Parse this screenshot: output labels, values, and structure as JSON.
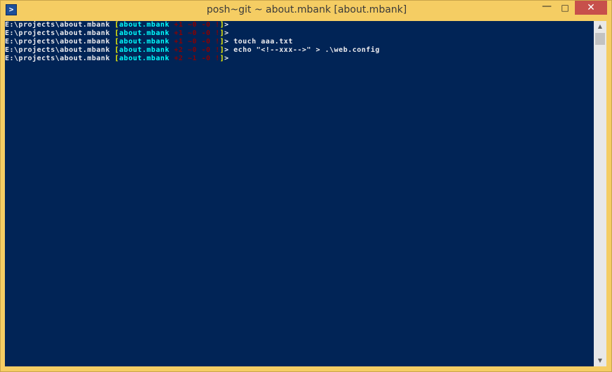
{
  "window": {
    "title": "posh~git ~ about.mbank [about.mbank]",
    "icon": "powershell-icon",
    "controls": {
      "minimize": "—",
      "maximize": "□",
      "close": "✕"
    }
  },
  "colors": {
    "console_bg": "#012456",
    "titlebar_bg": "#f5cd63",
    "path": "#eeedf0",
    "bracket": "#ffff00",
    "branch": "#00ffff",
    "status": "#8b0000",
    "close_button": "#c7504b"
  },
  "console": {
    "lines": [
      {
        "path": "E:\\projects\\about.mbank ",
        "open": "[",
        "branch": "about.mbank",
        "status": " +1 ~0 -0 !",
        "close": "]",
        "prompt": "> ",
        "command": ""
      },
      {
        "path": "E:\\projects\\about.mbank ",
        "open": "[",
        "branch": "about.mbank",
        "status": " +1 ~0 -0 !",
        "close": "]",
        "prompt": "> ",
        "command": ""
      },
      {
        "path": "E:\\projects\\about.mbank ",
        "open": "[",
        "branch": "about.mbank",
        "status": " +1 ~0 -0 !",
        "close": "]",
        "prompt": "> ",
        "command": "touch aaa.txt"
      },
      {
        "path": "E:\\projects\\about.mbank ",
        "open": "[",
        "branch": "about.mbank",
        "status": " +2 ~0 -0 !",
        "close": "]",
        "prompt": "> ",
        "command": "echo \"<!--xxx-->\" > .\\web.config"
      },
      {
        "path": "E:\\projects\\about.mbank ",
        "open": "[",
        "branch": "about.mbank",
        "status": " +2 ~1 -0 !",
        "close": "]",
        "prompt": "> ",
        "command": ""
      }
    ]
  },
  "scrollbar": {
    "up_arrow": "▲",
    "down_arrow": "▼"
  }
}
